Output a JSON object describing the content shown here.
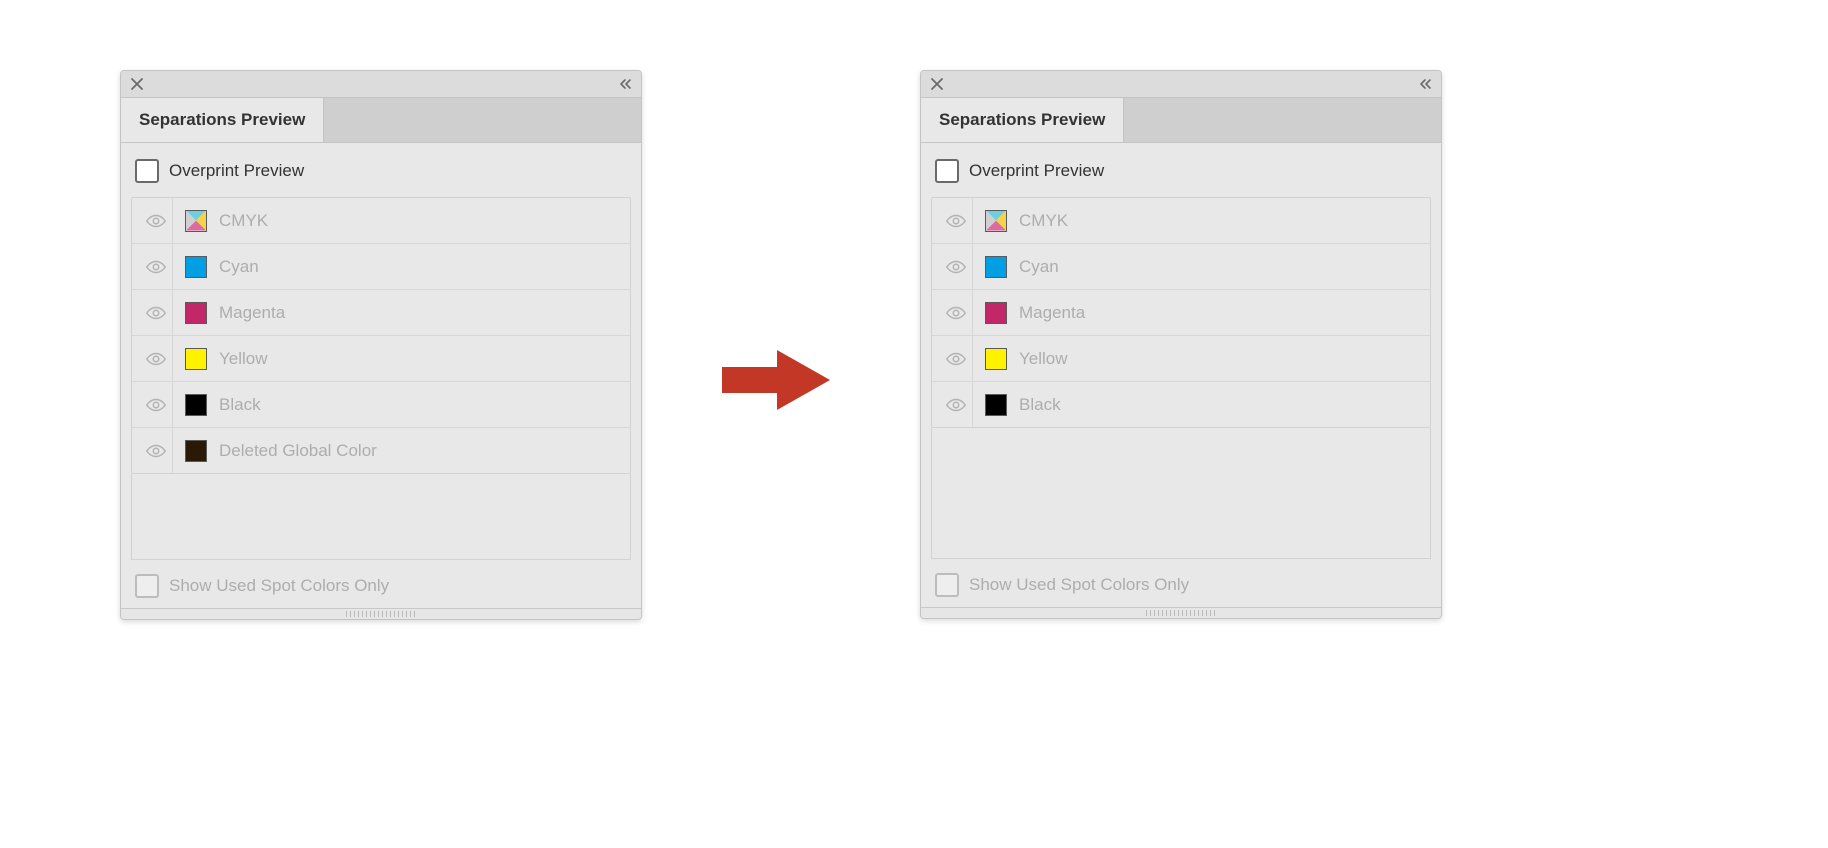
{
  "common": {
    "tab_label": "Separations Preview",
    "overprint_label": "Overprint Preview",
    "show_used_label": "Show Used Spot Colors Only",
    "eye_icon_name": "eye-icon",
    "swatches": {
      "cmyk": {
        "label": "CMYK",
        "sw": "cmyk"
      },
      "cyan": {
        "label": "Cyan",
        "sw": "cyan"
      },
      "magenta": {
        "label": "Magenta",
        "sw": "magenta"
      },
      "yellow": {
        "label": "Yellow",
        "sw": "yellow"
      },
      "black": {
        "label": "Black",
        "sw": "black"
      },
      "deleted": {
        "label": "Deleted Global Color",
        "sw": "deleted"
      }
    }
  },
  "leftPanel": {
    "rows": [
      "cmyk",
      "cyan",
      "magenta",
      "yellow",
      "black",
      "deleted"
    ]
  },
  "rightPanel": {
    "rows": [
      "cmyk",
      "cyan",
      "magenta",
      "yellow",
      "black"
    ]
  }
}
